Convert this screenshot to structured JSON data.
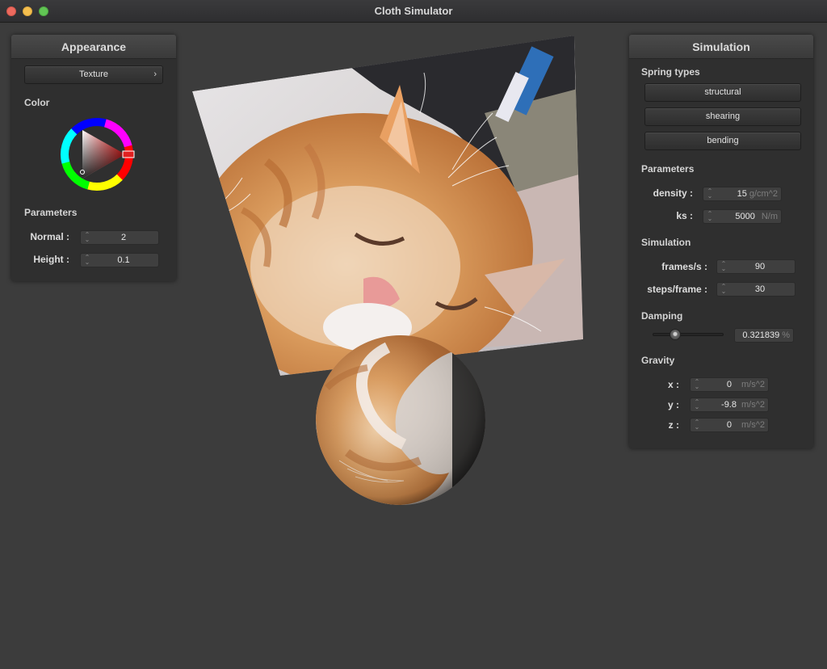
{
  "window": {
    "title": "Cloth Simulator"
  },
  "appearance": {
    "header": "Appearance",
    "texture_button": "Texture",
    "color_label": "Color",
    "params_label": "Parameters",
    "normal_label": "Normal :",
    "normal_value": "2",
    "height_label": "Height :",
    "height_value": "0.1"
  },
  "simulation": {
    "header": "Simulation",
    "spring_types_label": "Spring types",
    "spring_buttons": [
      "structural",
      "shearing",
      "bending"
    ],
    "params_label": "Parameters",
    "density_label": "density :",
    "density_value": "15",
    "density_unit": "g/cm^2",
    "ks_label": "ks :",
    "ks_value": "5000",
    "ks_unit": "N/m",
    "sim_label": "Simulation",
    "fps_label": "frames/s :",
    "fps_value": "90",
    "steps_label": "steps/frame :",
    "steps_value": "30",
    "damping_label": "Damping",
    "damping_value": "0.321839",
    "damping_unit": "%",
    "damping_slider_fraction": 0.32,
    "gravity_label": "Gravity",
    "gx_label": "x :",
    "gx_value": "0",
    "gy_label": "y :",
    "gy_value": "-9.8",
    "gz_label": "z :",
    "gz_value": "0",
    "gravity_unit": "m/s^2"
  },
  "colors": {
    "background": "#3c3c3c",
    "panel": "#2f2f2f",
    "selected_color": "#e02020"
  },
  "icons": {
    "spinner": "up-down-arrows",
    "chevron": "chevron-right"
  }
}
